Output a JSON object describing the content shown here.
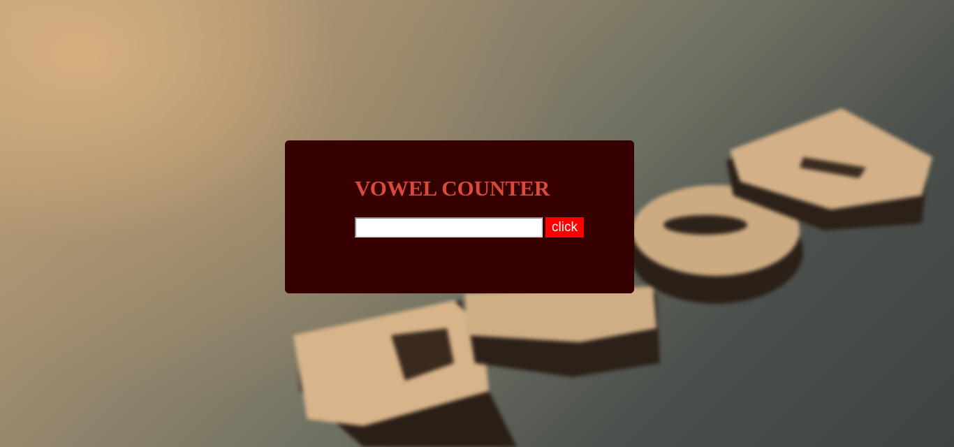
{
  "card": {
    "title": "VOWEL COUNTER",
    "input": {
      "value": "",
      "placeholder": ""
    },
    "button_label": "click"
  },
  "colors": {
    "card_background": "#360000",
    "title": "#d94a3c",
    "button_background": "#ff0000",
    "button_text": "#ffffff"
  }
}
